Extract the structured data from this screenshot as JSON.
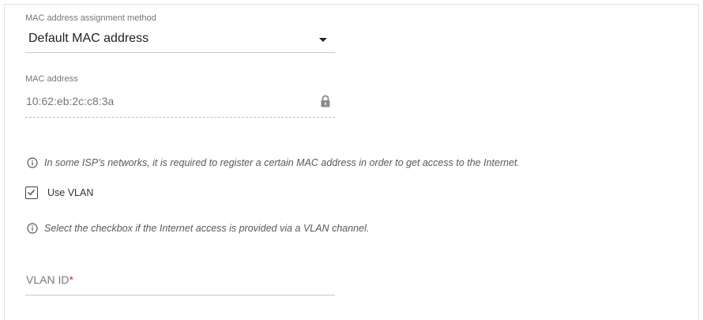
{
  "mac_method": {
    "label": "MAC address assignment method",
    "value": "Default MAC address"
  },
  "mac_address": {
    "label": "MAC address",
    "value": "10:62:eb:2c:c8:3a"
  },
  "info_isp": "In some ISP's networks, it is required to register a certain MAC address in order to get access to the Internet.",
  "use_vlan": {
    "label": "Use VLAN",
    "checked": true
  },
  "info_vlan": "Select the checkbox if the Internet access is provided via a VLAN channel.",
  "vlan_id": {
    "label": "VLAN ID",
    "required_mark": "*",
    "value": ""
  },
  "colors": {
    "required": "#d32f2f",
    "text": "#333333",
    "muted": "#777777"
  },
  "icons": {
    "dropdown": "chevron-down-icon",
    "lock": "lock-icon",
    "info": "info-icon",
    "check": "checkmark-icon"
  }
}
